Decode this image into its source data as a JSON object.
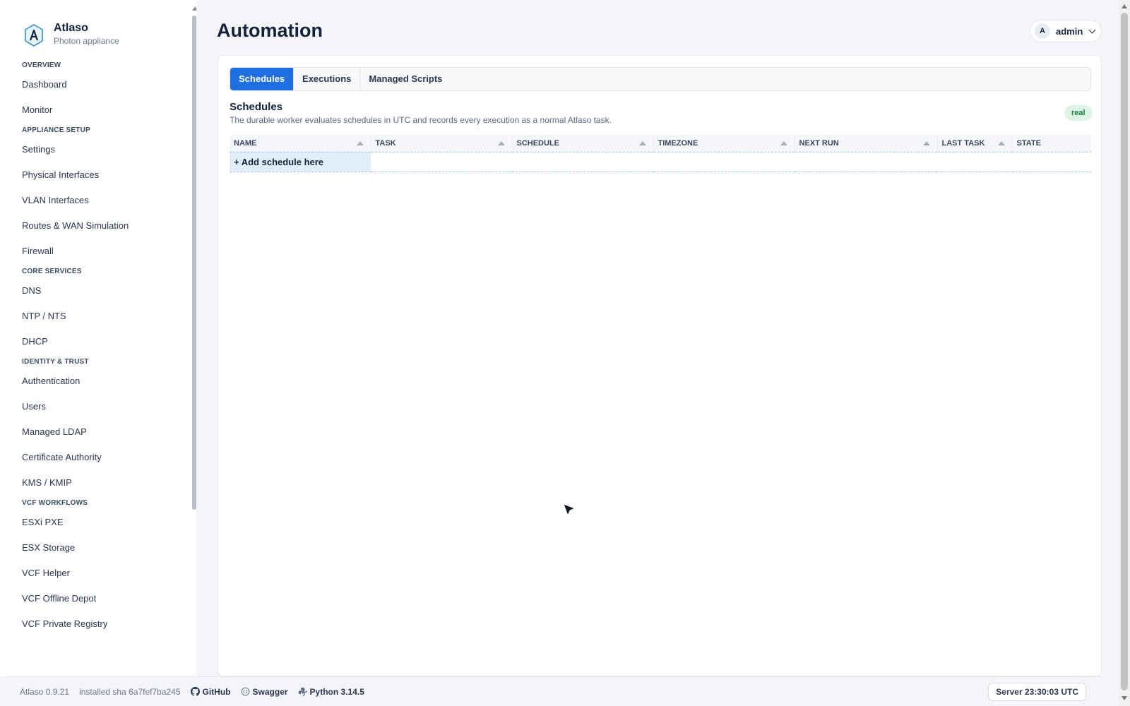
{
  "brand": {
    "title": "Atlaso",
    "subtitle": "Photon appliance"
  },
  "sidebar": {
    "sections": [
      {
        "label": "OVERVIEW",
        "items": [
          "Dashboard",
          "Monitor"
        ]
      },
      {
        "label": "APPLIANCE SETUP",
        "items": [
          "Settings",
          "Physical Interfaces",
          "VLAN Interfaces",
          "Routes & WAN Simulation",
          "Firewall"
        ]
      },
      {
        "label": "CORE SERVICES",
        "items": [
          "DNS",
          "NTP / NTS",
          "DHCP"
        ]
      },
      {
        "label": "IDENTITY & TRUST",
        "items": [
          "Authentication",
          "Users",
          "Managed LDAP",
          "Certificate Authority",
          "KMS / KMIP"
        ]
      },
      {
        "label": "VCF WORKFLOWS",
        "items": [
          "ESXi PXE",
          "ESX Storage",
          "VCF Helper",
          "VCF Offline Depot",
          "VCF Private Registry"
        ]
      }
    ]
  },
  "header": {
    "title": "Automation",
    "user_initial": "A",
    "user_name": "admin"
  },
  "tabs": [
    "Schedules",
    "Executions",
    "Managed Scripts"
  ],
  "section": {
    "title": "Schedules",
    "description": "The durable worker evaluates schedules in UTC and records every execution as a normal Atlaso task.",
    "badge": "real"
  },
  "table": {
    "columns": [
      "NAME",
      "TASK",
      "SCHEDULE",
      "TIMEZONE",
      "NEXT RUN",
      "LAST TASK",
      "STATE"
    ],
    "add_row_label": "+ Add schedule here"
  },
  "footer": {
    "version": "Atlaso 0.9.21",
    "sha": "installed sha 6a7fef7ba245",
    "github": "GitHub",
    "swagger": "Swagger",
    "python": "Python 3.14.5",
    "server_time": "Server 23:30:03 UTC"
  },
  "colors": {
    "accent": "#1f6fe0",
    "badge_bg": "#dcf5e4",
    "badge_fg": "#1b7a43"
  }
}
